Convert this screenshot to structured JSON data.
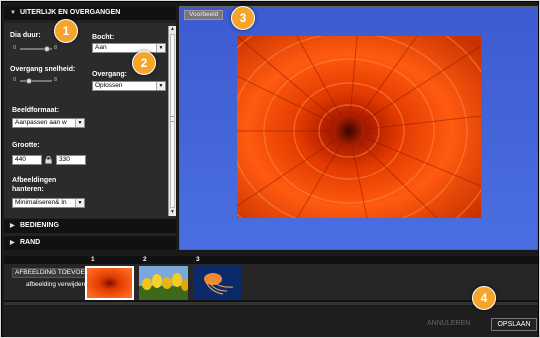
{
  "panel": {
    "appearance_header": "UITERLIJK EN OVERGANGEN",
    "dia_duur": {
      "label": "Dia duur:",
      "min": "0",
      "max": "8"
    },
    "bocht": {
      "label": "Bocht:",
      "value": "Aan"
    },
    "overgang_snelheid": {
      "label": "Overgang snelheid:",
      "min": "0",
      "max": "8"
    },
    "overgang": {
      "label": "Overgang:",
      "value": "Oplossen"
    },
    "beeldformaat": {
      "label": "Beeldformaat:",
      "value": "Aanpassen aan w"
    },
    "grootte": {
      "label": "Grootte:",
      "width": "440",
      "height": "330"
    },
    "afbeeldingen": {
      "label_line1": "Afbeeldingen",
      "label_line2": "hanteren:",
      "value": "Minimaliseren& In"
    },
    "bediening_header": "BEDIENING",
    "rand_header": "RAND"
  },
  "preview": {
    "tab_label": "Voorbeeld"
  },
  "filmstrip": {
    "add_button": "AFBEELDING TOEVOEGEN",
    "remove_link": "afbeelding verwijderen",
    "thumbnails": [
      {
        "number": "1",
        "subject": "orange-flower-photo",
        "selected": true
      },
      {
        "number": "2",
        "subject": "yellow-tulips-photo",
        "selected": false
      },
      {
        "number": "3",
        "subject": "jellyfish-photo",
        "selected": false
      }
    ]
  },
  "footer": {
    "cancel_label": "ANNULEREN",
    "save_label": "OPSLAAN"
  },
  "callouts": [
    "1",
    "2",
    "3",
    "4"
  ],
  "colors": {
    "callout": "#f6a52a",
    "preview_bg": "#4a6fe0",
    "panel_bg": "#2b2b2b"
  }
}
